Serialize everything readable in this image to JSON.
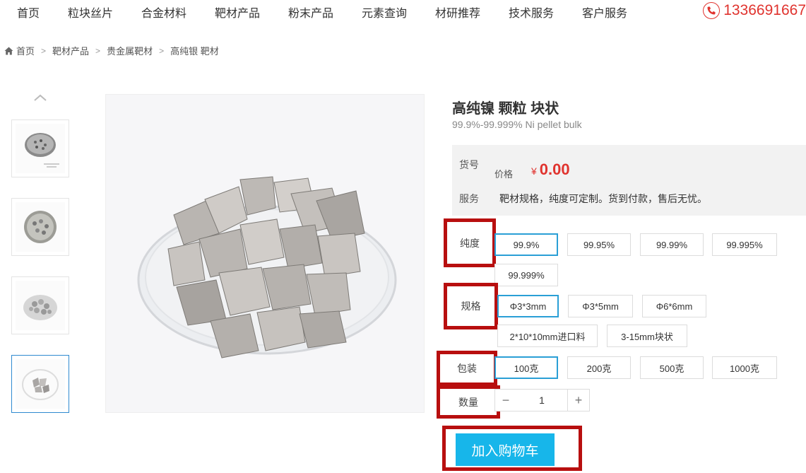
{
  "nav": {
    "items": [
      "首页",
      "粒块丝片",
      "合金材料",
      "靶材产品",
      "粉末产品",
      "元素查询",
      "材研推荐",
      "技术服务",
      "客户服务"
    ],
    "phone": "1336691667"
  },
  "breadcrumb": {
    "items": [
      "首页",
      "靶材产品",
      "贵金属靶材",
      "高纯银 靶材"
    ]
  },
  "product": {
    "title": "高纯镍 颗粒 块状",
    "subtitle": "99.9%-99.999% Ni pellet bulk",
    "sku_label": "货号",
    "price_label": "价格",
    "price_symbol": "¥",
    "price_value": "0.00",
    "service_label": "服务",
    "service_text": "靶材规格，纯度可定制。货到付款，售后无忧。"
  },
  "options": {
    "purity": {
      "label": "纯度",
      "values": [
        "99.9%",
        "99.95%",
        "99.99%",
        "99.995%",
        "99.999%"
      ],
      "selected": "99.9%"
    },
    "spec": {
      "label": "规格",
      "values": [
        "Φ3*3mm",
        "Φ3*5mm",
        "Φ6*6mm",
        "2*10*10mm进口料",
        "3-15mm块状"
      ],
      "selected": "Φ3*3mm"
    },
    "package": {
      "label": "包装",
      "values": [
        "100克",
        "200克",
        "500克",
        "1000克"
      ],
      "selected": "100克"
    },
    "quantity": {
      "label": "数量",
      "value": "1",
      "minus": "−",
      "plus": "+"
    }
  },
  "cart": {
    "label": "加入购物车"
  },
  "colors": {
    "accent": "#17b6ea",
    "price": "#e0332e",
    "highlight": "#b80f0f"
  }
}
